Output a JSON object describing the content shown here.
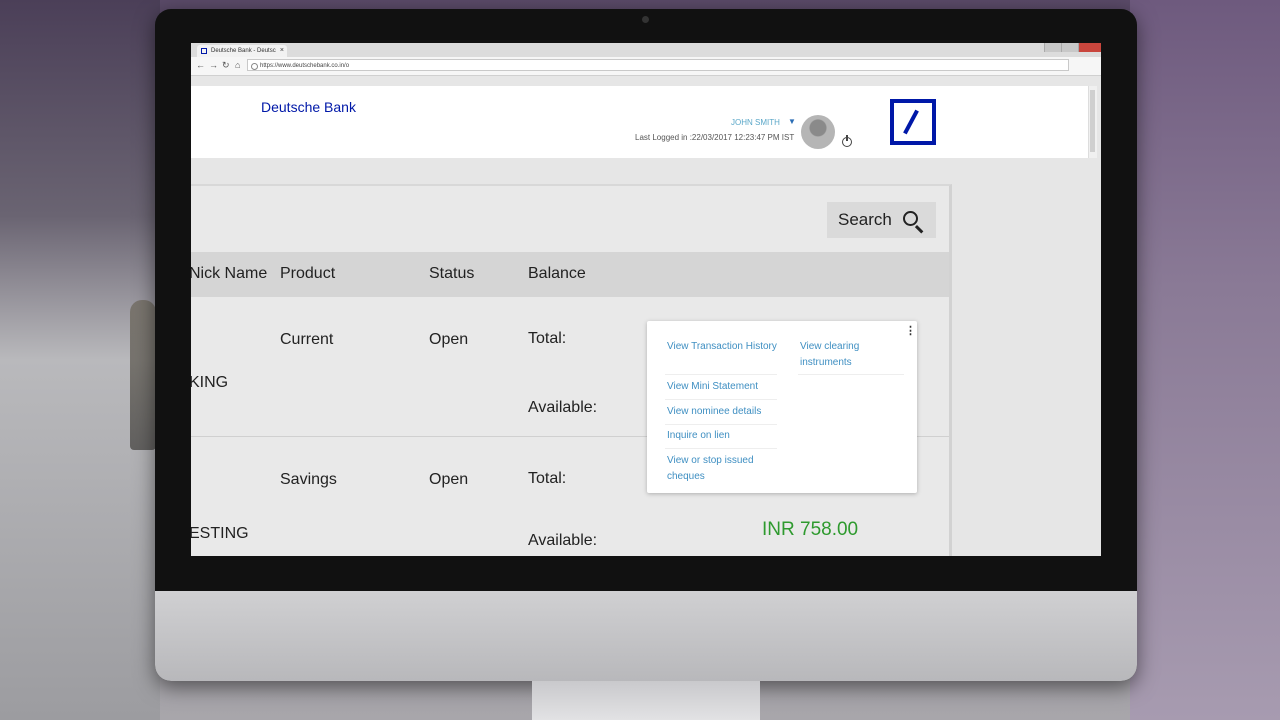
{
  "browser": {
    "tab_title": "Deutsche Bank - Deutsc",
    "tab_close": "×",
    "url": "https://www.deutschebank.co.in/o",
    "nav": {
      "back": "←",
      "forward": "→",
      "reload": "↻",
      "home": "⌂"
    }
  },
  "header": {
    "brand": "Deutsche Bank",
    "username": "JOHN SMITH",
    "last_logged_in": "Last Logged in :22/03/2017 12:23:47 PM IST"
  },
  "search": {
    "label": "Search"
  },
  "table": {
    "headers": [
      "Nick Name",
      "Product",
      "Status",
      "Balance"
    ],
    "rows": [
      {
        "nick_name": "KING",
        "product": "Current",
        "status": "Open",
        "total_label": "Total:",
        "available_label": "Available:",
        "available": ""
      },
      {
        "nick_name": "ESTING",
        "product": "Savings",
        "status": "Open",
        "total_label": "Total:",
        "available_label": "Available:",
        "available": "INR 758.00"
      }
    ]
  },
  "context_menu": {
    "kebab": "⋮",
    "left_items": [
      "View Transaction History",
      "View Mini Statement",
      "View nominee details",
      "Inquire on lien",
      "View or stop issued cheques"
    ],
    "right_items": [
      "View clearing instruments"
    ]
  },
  "colors": {
    "brand_blue": "#0018a8",
    "amount_green": "#2e9a2e",
    "menu_link": "#3f8fc2"
  }
}
